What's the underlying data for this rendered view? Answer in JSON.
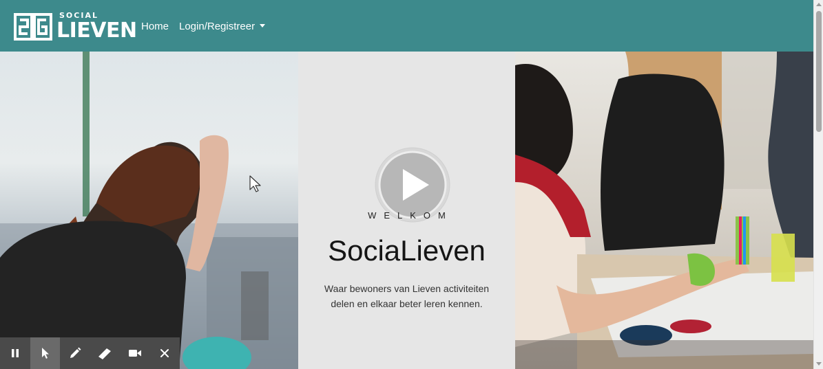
{
  "navbar": {
    "brand_top": "SOCIAL",
    "brand_main": "LIEVEN",
    "home_label": "Home",
    "login_label": "Login/Registreer",
    "background": "#3d8a8c"
  },
  "hero": {
    "eyebrow": "WELKOM",
    "title": "SociaLieven",
    "subtitle_line1": "Waar bewoners van Lieven activiteiten",
    "subtitle_line2": "delen en elkaar beter leren kennen."
  },
  "toolbar": {
    "items": [
      {
        "icon": "pause-icon"
      },
      {
        "icon": "pointer-icon",
        "active": true
      },
      {
        "icon": "pen-icon"
      },
      {
        "icon": "highlighter-icon"
      },
      {
        "icon": "video-camera-icon"
      },
      {
        "icon": "close-icon"
      }
    ]
  }
}
